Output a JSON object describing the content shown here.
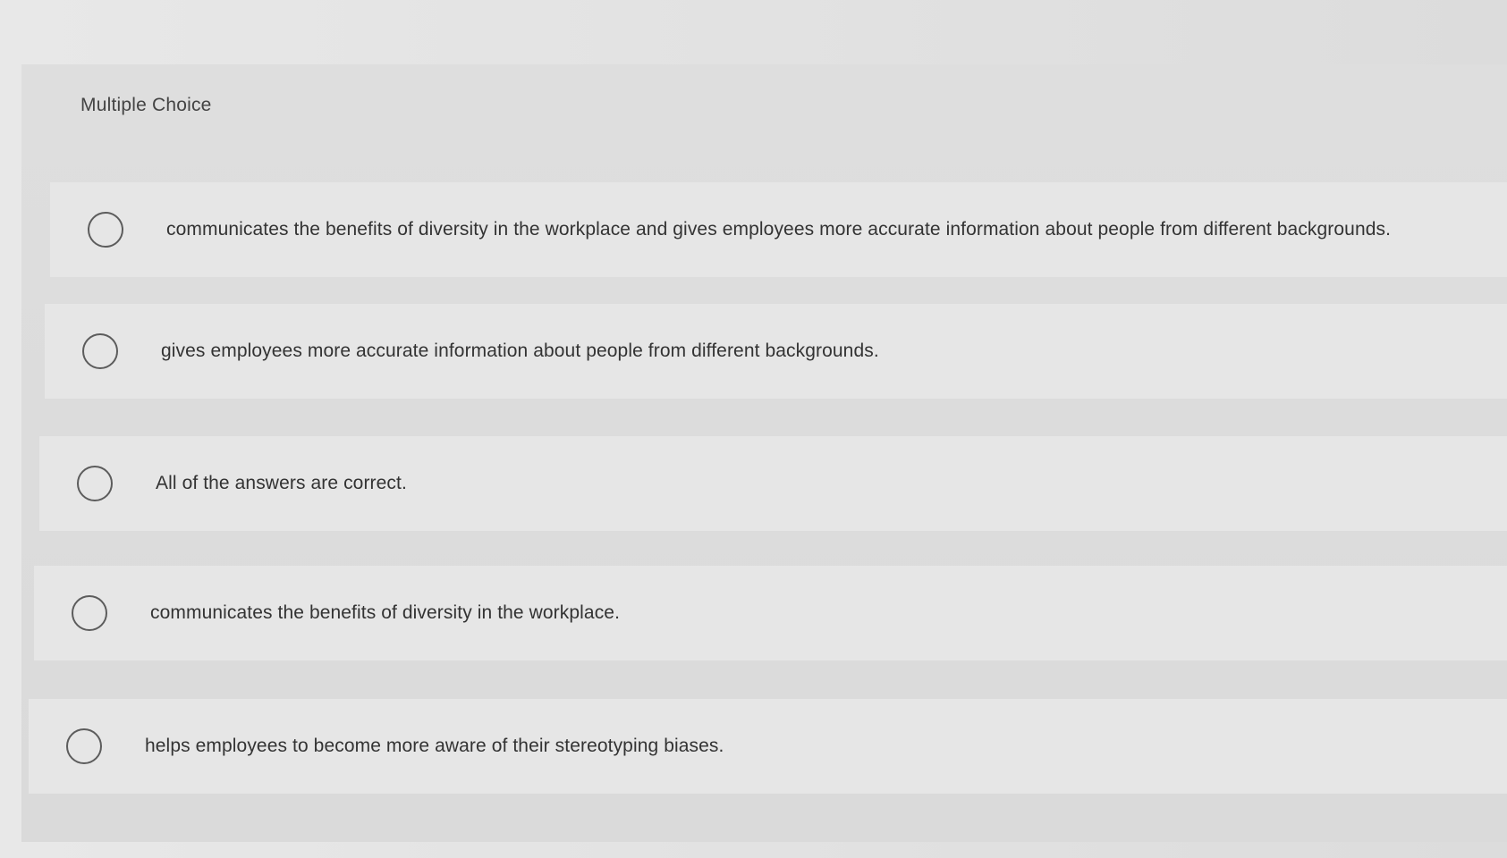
{
  "section": {
    "title": "Multiple Choice"
  },
  "choices": [
    {
      "label": "communicates the benefits of diversity in the workplace and gives employees more accurate information about people from different backgrounds."
    },
    {
      "label": "gives employees more accurate information about people from different backgrounds."
    },
    {
      "label": "All of the answers are correct."
    },
    {
      "label": "communicates the benefits of diversity in the workplace."
    },
    {
      "label": "helps employees to become more aware of their stereotyping biases."
    }
  ],
  "icons": {
    "radio": "radio-unselected-icon"
  },
  "colors": {
    "background": "#e2e2e2",
    "panel": "#dadada",
    "choice_row": "#e6e6e6",
    "text": "#333333",
    "radio_border": "#5c5c5c"
  }
}
